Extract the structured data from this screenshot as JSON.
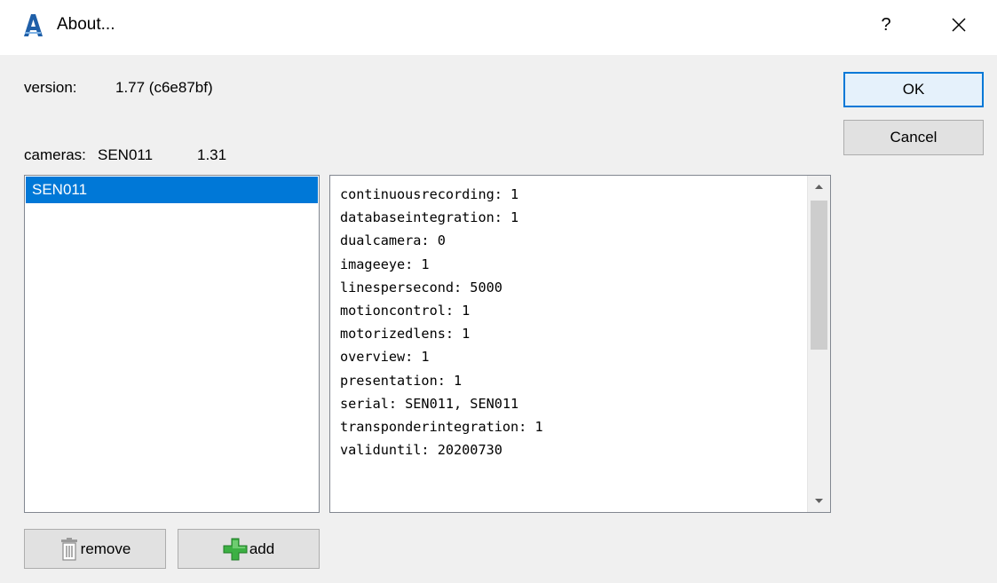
{
  "window": {
    "title": "About...",
    "help_label": "?"
  },
  "version": {
    "label": "version:",
    "value": "1.77 (c6e87bf)"
  },
  "cameras": {
    "label": "cameras:",
    "value": "SEN011",
    "number": "1.31"
  },
  "camera_list": {
    "items": [
      "SEN011"
    ],
    "selected_index": 0
  },
  "details": {
    "lines": [
      "continuousrecording: 1",
      "databaseintegration: 1",
      "dualcamera: 0",
      "imageeye: 1",
      "linespersecond: 5000",
      "motioncontrol: 1",
      "motorizedlens: 1",
      "overview: 1",
      "presentation: 1",
      "serial: SEN011, SEN011",
      "transponderintegration: 1",
      "validuntil: 20200730",
      "",
      "",
      "================================"
    ]
  },
  "buttons": {
    "ok": "OK",
    "cancel": "Cancel",
    "remove": "remove",
    "add": "add"
  },
  "colors": {
    "accent": "#0078d7",
    "add_icon": "#3cb043"
  },
  "icons": {
    "app": "app-logo-icon",
    "close": "close-icon",
    "remove": "trash-icon",
    "add": "plus-icon"
  }
}
